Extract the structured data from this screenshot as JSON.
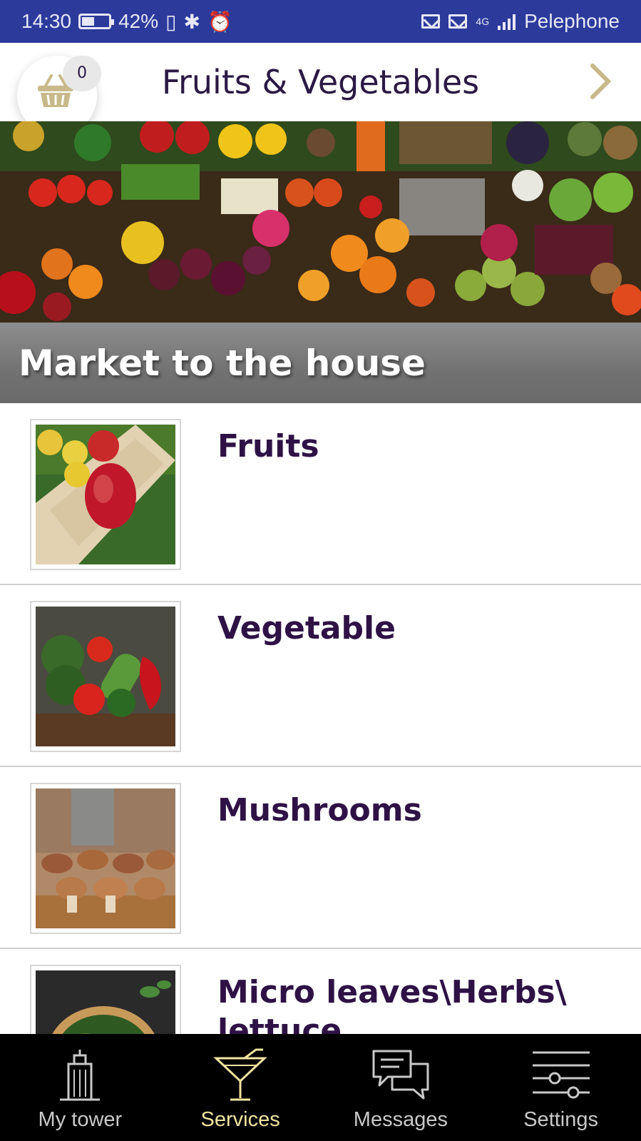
{
  "status_bar": {
    "time": "14:30",
    "battery": "42%",
    "carrier": "Pelephone",
    "network": "4G"
  },
  "header": {
    "title": "Fruits & Vegetables",
    "cart_count": "0",
    "accent_color": "#c8b98a",
    "title_color": "#2a1a44"
  },
  "banner": {
    "caption": "Market to the house"
  },
  "categories": [
    {
      "title": "Fruits",
      "image": "apples-crate"
    },
    {
      "title": "Vegetable",
      "image": "vegetables-board"
    },
    {
      "title": "Mushrooms",
      "image": "mushrooms-table"
    },
    {
      "title": "Micro leaves\\Herbs\\ lettuce",
      "image": "leaves-bowl"
    }
  ],
  "bottom_nav": {
    "items": [
      {
        "label": "My tower",
        "icon": "building-icon",
        "active": false
      },
      {
        "label": "Services",
        "icon": "cocktail-icon",
        "active": true
      },
      {
        "label": "Messages",
        "icon": "chat-bubbles-icon",
        "active": false
      },
      {
        "label": "Settings",
        "icon": "sliders-icon",
        "active": false
      }
    ],
    "active_color": "#f1e4a0"
  }
}
